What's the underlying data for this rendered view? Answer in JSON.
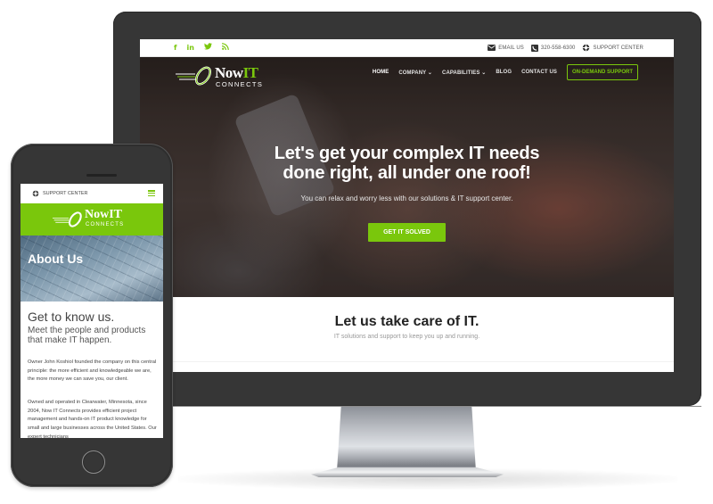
{
  "desktop": {
    "topbar": {
      "social": [
        {
          "icon": "facebook-icon",
          "glyph": "f"
        },
        {
          "icon": "linkedin-icon",
          "glyph": "in"
        },
        {
          "icon": "twitter-icon",
          "glyph": "♥"
        },
        {
          "icon": "rss-icon",
          "glyph": "⚞"
        }
      ],
      "contact": {
        "email": "EMAIL US",
        "phone": "320-558-6300",
        "support": "SUPPORT CENTER"
      }
    },
    "logo": {
      "now": "Now",
      "it": "IT",
      "connects": "CONNECTS"
    },
    "nav": {
      "home": "HOME",
      "company": "COMPANY ⌄",
      "capabilities": "CAPABILITIES ⌄",
      "blog": "BLOG",
      "contact": "CONTACT US",
      "cta": "ON-DEMAND SUPPORT"
    },
    "hero": {
      "title_line1": "Let's get your complex IT needs",
      "title_line2": "done right, all under one roof!",
      "subtitle": "You can relax and worry less with our solutions & IT support center.",
      "button": "GET IT SOLVED"
    },
    "section": {
      "title": "Let us take care of IT.",
      "subtitle": "IT solutions and support to keep you up and running."
    }
  },
  "mobile": {
    "support": "SUPPORT CENTER",
    "logo": {
      "now": "Now",
      "it": "IT",
      "connects": "CONNECTS"
    },
    "about_title": "About Us",
    "heading": "Get to know us.",
    "subheading": "Meet the people and products that make IT happen.",
    "paragraph1": "Owner John Koshiol founded the company on this central principle: the more efficient and knowledgeable we are, the more money we can save you, our client.",
    "paragraph2": "Owned and operated in Clearwater, Minnesota, since 2004, Now IT Connects provides efficient project management and hands-on IT product knowledge for small and large businesses across the United States. Our expert technicians"
  },
  "colors": {
    "brand_green": "#7ac70c",
    "bezel": "#363636"
  }
}
